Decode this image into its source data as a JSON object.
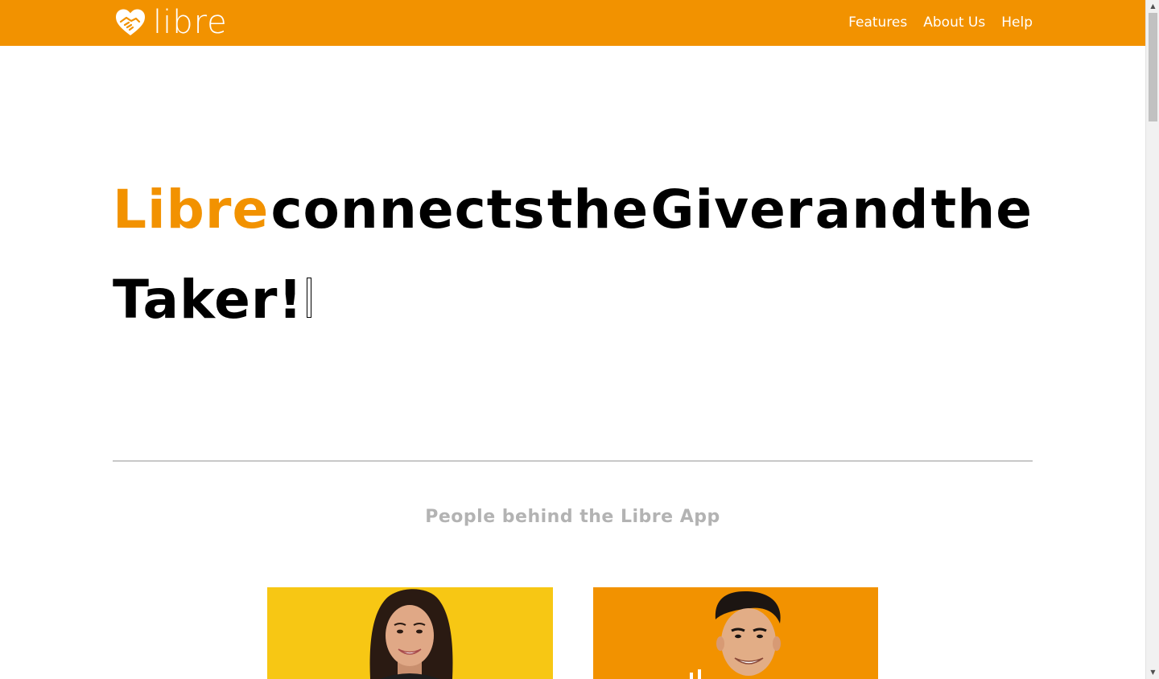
{
  "navbar": {
    "brand_text": "libre",
    "brand_icon": "heart-handshake-icon",
    "links": [
      {
        "label": "Features"
      },
      {
        "label": "About Us"
      },
      {
        "label": "Help"
      }
    ],
    "color": "#f29200"
  },
  "hero": {
    "accent_word": "Libre",
    "words": [
      "connects",
      "the",
      "Giver",
      "and",
      "the"
    ],
    "line2": "Taker!",
    "accent_color": "#f29200"
  },
  "team": {
    "title": "People behind the Libre App",
    "cards": [
      {
        "background": "#f7c714",
        "icon": "woman-portrait"
      },
      {
        "background": "#f29200",
        "icon": "man-portrait"
      }
    ]
  },
  "scrollbar": {
    "up_icon": "scroll-up-arrow-icon",
    "down_icon": "scroll-down-arrow-icon"
  }
}
